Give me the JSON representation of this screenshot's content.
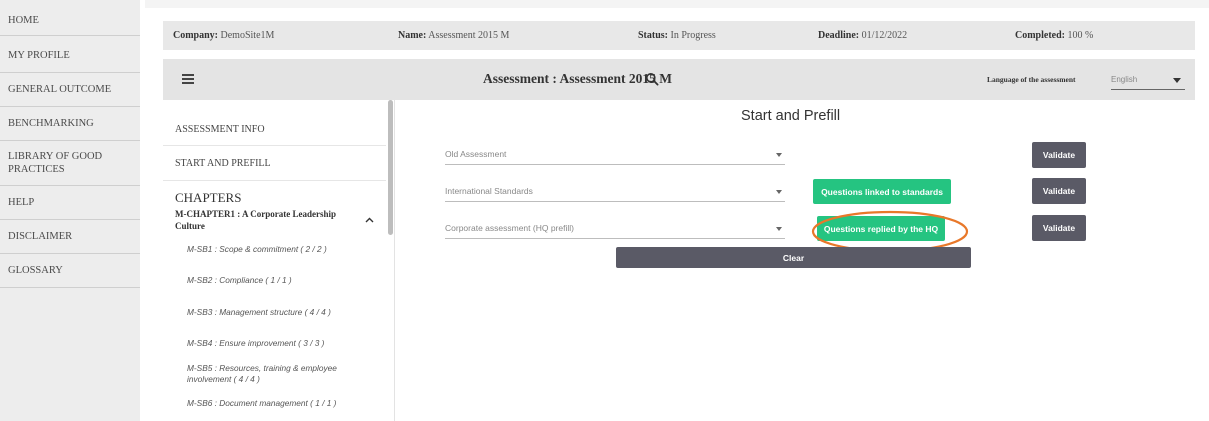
{
  "nav": {
    "items": [
      {
        "label": "HOME"
      },
      {
        "label": "MY PROFILE"
      },
      {
        "label": "GENERAL OUTCOME"
      },
      {
        "label": "BENCHMARKING"
      },
      {
        "label": "LIBRARY OF GOOD PRACTICES"
      },
      {
        "label": "HELP"
      },
      {
        "label": "DISCLAIMER"
      },
      {
        "label": "GLOSSARY"
      }
    ]
  },
  "info": {
    "company_label": "Company:",
    "company_value": "DemoSite1M",
    "name_label": "Name:",
    "name_value": "Assessment 2015 M",
    "status_label": "Status:",
    "status_value": "In Progress",
    "deadline_label": "Deadline:",
    "deadline_value": "01/12/2022",
    "completed_label": "Completed:",
    "completed_value": "100 %"
  },
  "header": {
    "title": "Assessment : Assessment 2015 M",
    "language_label": "Language of the assessment",
    "language_value": "English",
    "icons": {
      "menu": "hamburger-icon",
      "search": "search-icon",
      "dropdown": "caret-down-icon"
    }
  },
  "sidebar": {
    "assessment_info": "ASSESSMENT INFO",
    "start_prefill": "START AND PREFILL",
    "chapters_heading": "CHAPTERS",
    "chapter_title": "M-CHAPTER1 : A Corporate Leadership Culture",
    "sub_items": [
      {
        "label": "M-SB1 : Scope & commitment ( 2 / 2 )"
      },
      {
        "label": "M-SB2 : Compliance ( 1 / 1 )"
      },
      {
        "label": "M-SB3 : Management structure ( 4 / 4 )"
      },
      {
        "label": "M-SB4 : Ensure improvement ( 3 / 3 )"
      },
      {
        "label": "M-SB5 : Resources, training & employee involvement ( 4 / 4 )"
      },
      {
        "label": "M-SB6 : Document management ( 1 / 1 )"
      }
    ]
  },
  "main": {
    "title": "Start and Prefill",
    "fields": {
      "old_assessment": "Old Assessment",
      "international_standards": "International Standards",
      "corporate_assessment": "Corporate assessment (HQ prefill)"
    },
    "buttons": {
      "validate": "Validate",
      "questions_linked": "Questions linked to standards",
      "questions_replied": "Questions replied by the HQ",
      "clear": "Clear"
    }
  },
  "colors": {
    "green": "#25c481",
    "dark_button": "#5a5a66",
    "annotation": "#e8782a"
  }
}
